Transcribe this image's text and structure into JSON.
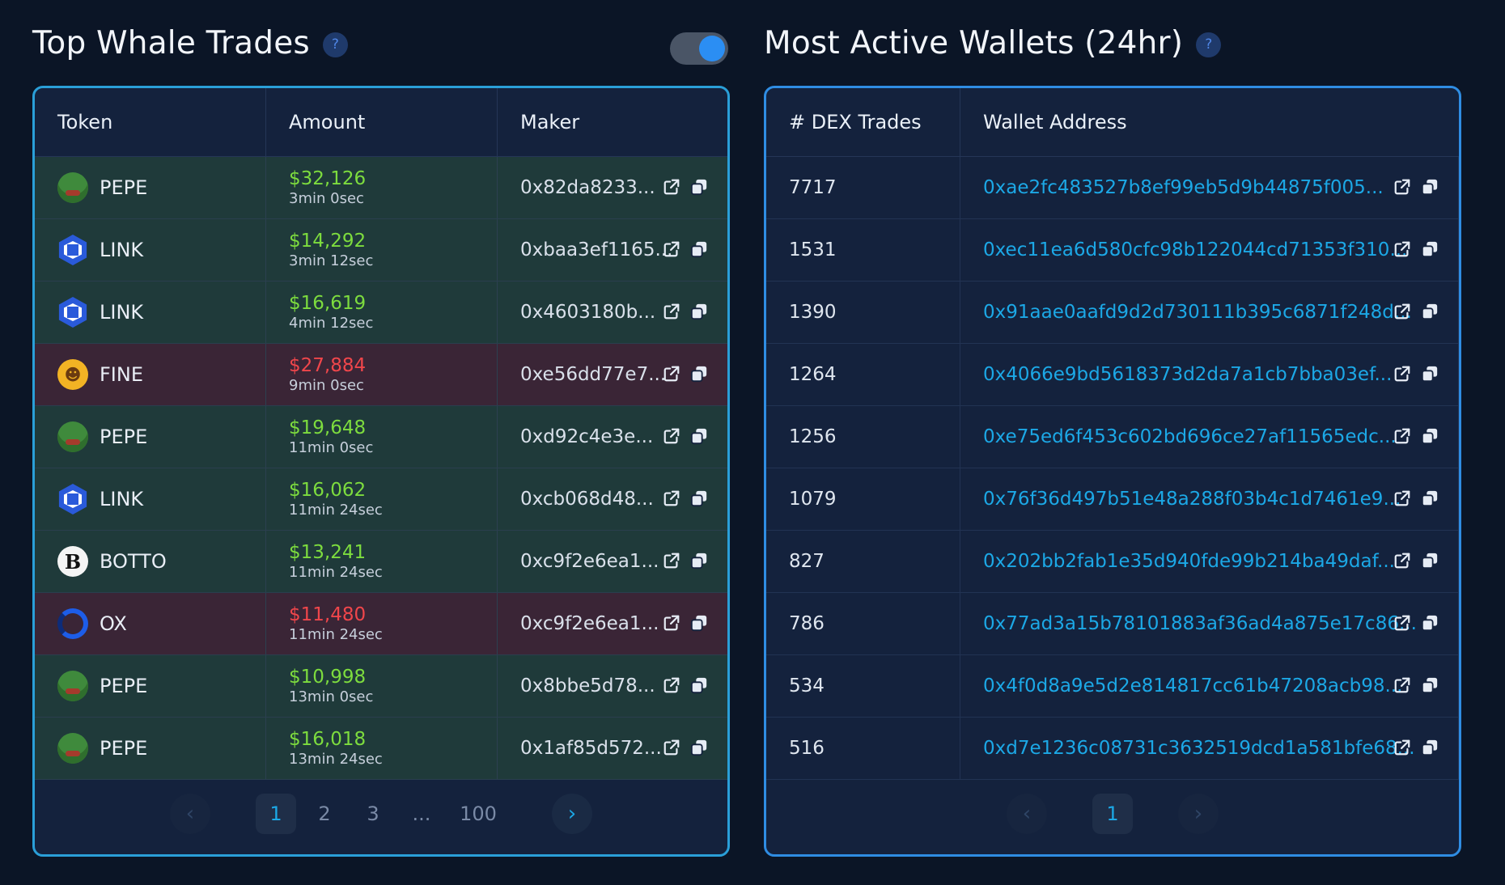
{
  "whale": {
    "title": "Top Whale Trades",
    "help": "?",
    "columns": [
      "Token",
      "Amount",
      "Maker"
    ],
    "rows": [
      {
        "icon": "pepe-icon",
        "token": "PEPE",
        "amount": "$32,126",
        "ago": "3min 0sec",
        "maker": "0x82da8233...",
        "side": "buy"
      },
      {
        "icon": "chainlink-icon",
        "token": "LINK",
        "amount": "$14,292",
        "ago": "3min 12sec",
        "maker": "0xbaa3ef1165...",
        "side": "buy"
      },
      {
        "icon": "chainlink-icon",
        "token": "LINK",
        "amount": "$16,619",
        "ago": "4min 12sec",
        "maker": "0x4603180b...",
        "side": "buy"
      },
      {
        "icon": "fine-icon",
        "token": "FINE",
        "amount": "$27,884",
        "ago": "9min 0sec",
        "maker": "0xe56dd77e7...",
        "side": "sell"
      },
      {
        "icon": "pepe-icon",
        "token": "PEPE",
        "amount": "$19,648",
        "ago": "11min 0sec",
        "maker": "0xd92c4e3e...",
        "side": "buy"
      },
      {
        "icon": "chainlink-icon",
        "token": "LINK",
        "amount": "$16,062",
        "ago": "11min 24sec",
        "maker": "0xcb068d48...",
        "side": "buy"
      },
      {
        "icon": "botto-icon",
        "token": "BOTTO",
        "amount": "$13,241",
        "ago": "11min 24sec",
        "maker": "0xc9f2e6ea1...",
        "side": "buy"
      },
      {
        "icon": "ox-icon",
        "token": "OX",
        "amount": "$11,480",
        "ago": "11min 24sec",
        "maker": "0xc9f2e6ea1...",
        "side": "sell"
      },
      {
        "icon": "pepe-icon",
        "token": "PEPE",
        "amount": "$10,998",
        "ago": "13min 0sec",
        "maker": "0x8bbe5d78...",
        "side": "buy"
      },
      {
        "icon": "pepe-icon",
        "token": "PEPE",
        "amount": "$16,018",
        "ago": "13min 24sec",
        "maker": "0x1af85d572...",
        "side": "buy"
      }
    ],
    "pager": {
      "prev": "‹",
      "pages": [
        "1",
        "2",
        "3",
        "...",
        "100"
      ],
      "active": "1",
      "next": "›"
    }
  },
  "wallets": {
    "title": "Most Active Wallets (24hr)",
    "help": "?",
    "columns": [
      "# DEX Trades",
      "Wallet Address"
    ],
    "rows": [
      {
        "trades": "7717",
        "address": "0xae2fc483527b8ef99eb5d9b44875f005..."
      },
      {
        "trades": "1531",
        "address": "0xec11ea6d580cfc98b122044cd71353f310..."
      },
      {
        "trades": "1390",
        "address": "0x91aae0aafd9d2d730111b395c6871f248d..."
      },
      {
        "trades": "1264",
        "address": "0x4066e9bd5618373d2da7a1cb7bba03ef..."
      },
      {
        "trades": "1256",
        "address": "0xe75ed6f453c602bd696ce27af11565edc..."
      },
      {
        "trades": "1079",
        "address": "0x76f36d497b51e48a288f03b4c1d7461e9..."
      },
      {
        "trades": "827",
        "address": "0x202bb2fab1e35d940fde99b214ba49daf..."
      },
      {
        "trades": "786",
        "address": "0x77ad3a15b78101883af36ad4a875e17c86..."
      },
      {
        "trades": "534",
        "address": "0x4f0d8a9e5d2e814817cc61b47208acb98..."
      },
      {
        "trades": "516",
        "address": "0xd7e1236c08731c3632519dcd1a581bfe68..."
      }
    ],
    "pager": {
      "prev": "‹",
      "pages": [
        "1"
      ],
      "active": "1",
      "next": "›"
    }
  },
  "colors": {
    "buy_bg": "#1f3a3a",
    "sell_bg": "#3a2536",
    "buy_text": "#7ddc3e",
    "sell_text": "#f0464b",
    "link": "#1ca8e6",
    "accent_border": "#2a9fd8"
  }
}
